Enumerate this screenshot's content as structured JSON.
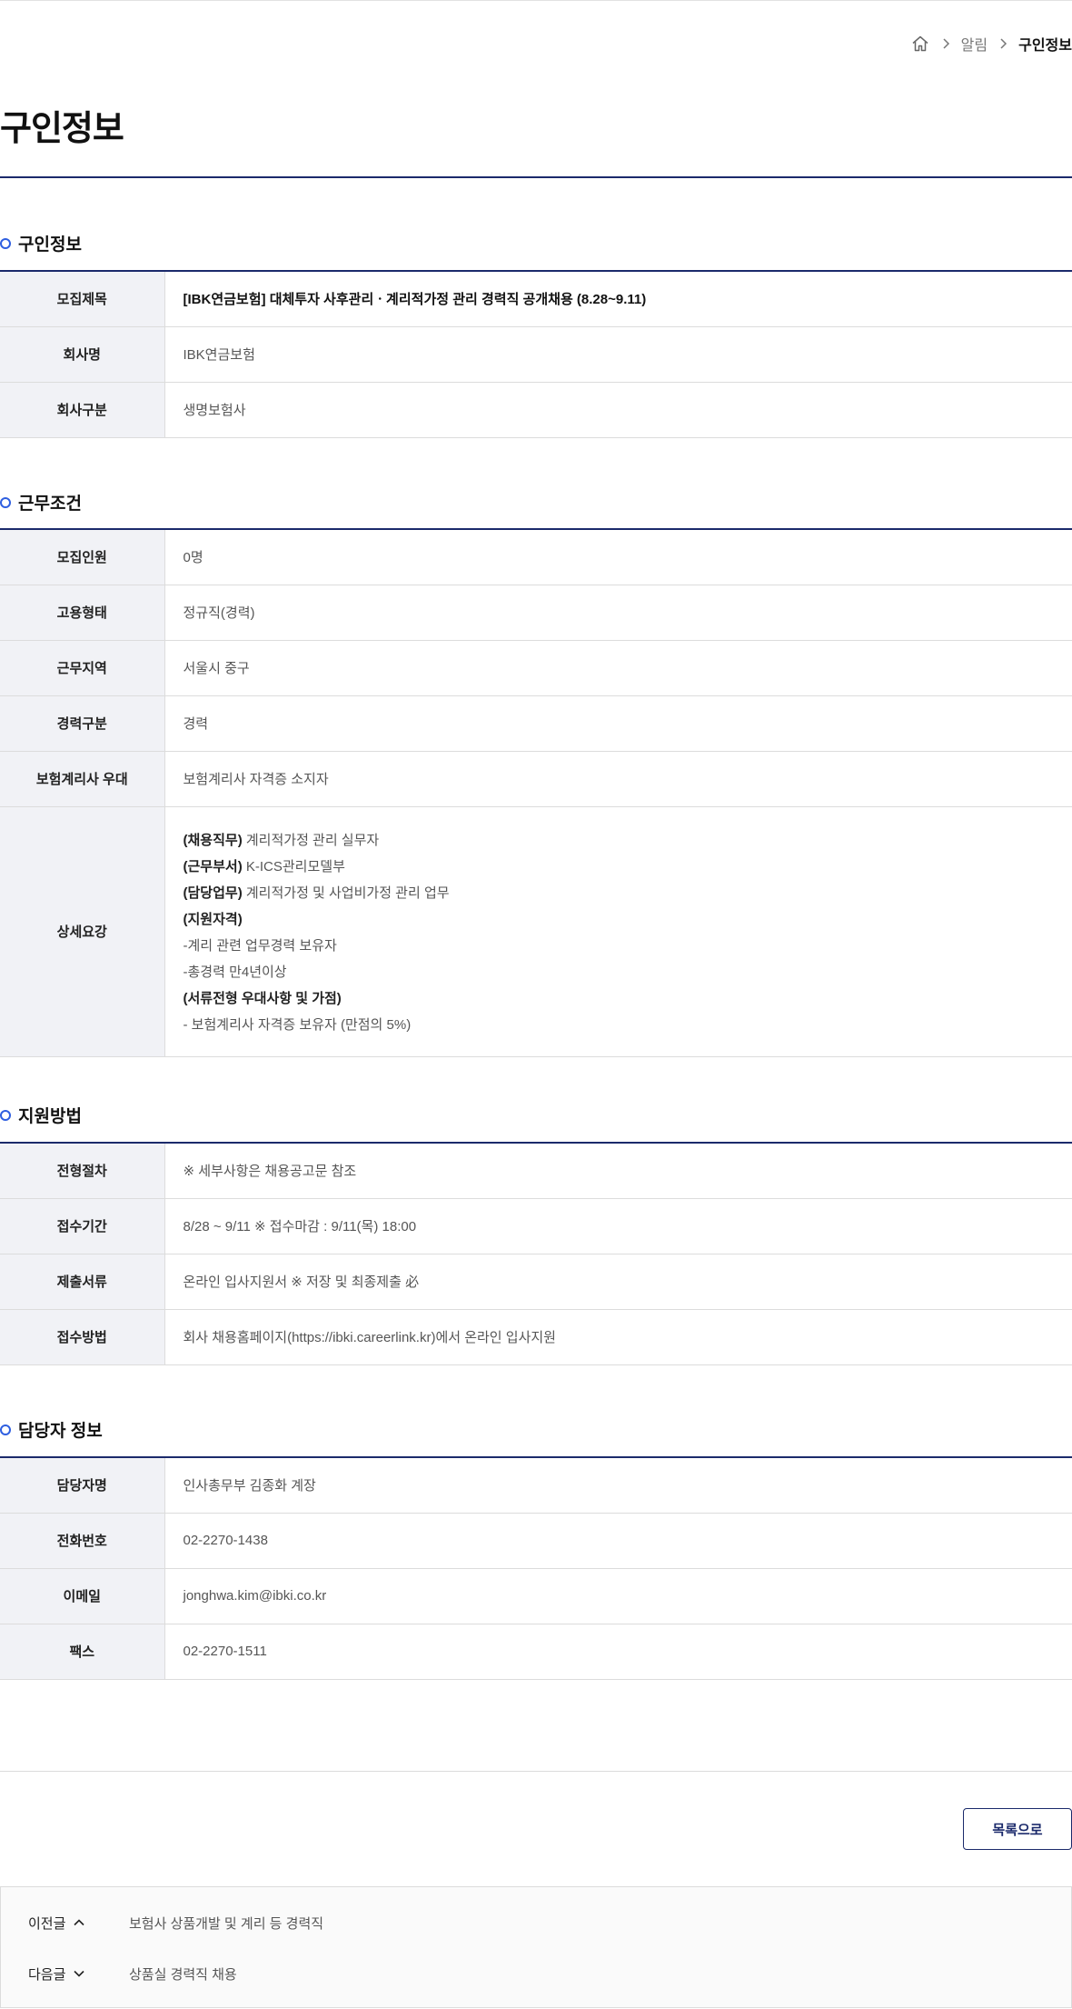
{
  "breadcrumb": {
    "home_icon": "home-icon",
    "items": [
      "알림",
      "구인정보"
    ]
  },
  "page_title": "구인정보",
  "sections": {
    "job_info": {
      "title": "구인정보",
      "rows": [
        {
          "label": "모집제목",
          "value": "[IBK연금보험] 대체투자 사후관리ㆍ계리적가정 관리 경력직 공개채용 (8.28~9.11)"
        },
        {
          "label": "회사명",
          "value": "IBK연금보험"
        },
        {
          "label": "회사구분",
          "value": "생명보험사"
        }
      ]
    },
    "work_conditions": {
      "title": "근무조건",
      "rows": [
        {
          "label": "모집인원",
          "value": "0명"
        },
        {
          "label": "고용형태",
          "value": "정규직(경력)"
        },
        {
          "label": "근무지역",
          "value": "서울시 중구"
        },
        {
          "label": "경력구분",
          "value": "경력"
        },
        {
          "label": "보험계리사 우대",
          "value": "보험계리사 자격증 소지자"
        }
      ],
      "detail": {
        "label": "상세요강",
        "lines": [
          {
            "bold": "(채용직무)",
            "text": " 계리적가정 관리 실무자"
          },
          {
            "bold": "(근무부서)",
            "text": " K-ICS관리모델부"
          },
          {
            "bold": "(담당업무)",
            "text": " 계리적가정 및 사업비가정 관리 업무"
          },
          {
            "bold": "(지원자격)",
            "text": ""
          },
          {
            "bold": "",
            "text": "-계리 관련 업무경력 보유자"
          },
          {
            "bold": "",
            "text": "-총경력 만4년이상"
          },
          {
            "bold": "(서류전형 우대사항 및 가점)",
            "text": ""
          },
          {
            "bold": "",
            "text": "- 보험계리사 자격증 보유자 (만점의 5%)"
          }
        ]
      }
    },
    "apply_method": {
      "title": "지원방법",
      "rows": [
        {
          "label": "전형절차",
          "value": "※ 세부사항은 채용공고문 참조"
        },
        {
          "label": "접수기간",
          "value": "8/28 ~ 9/11 ※ 접수마감 : 9/11(목) 18:00"
        },
        {
          "label": "제출서류",
          "value": "온라인 입사지원서 ※ 저장 및 최종제출 必"
        },
        {
          "label": "접수방법",
          "value": "회사 채용홈페이지(https://ibki.careerlink.kr)에서 온라인 입사지원"
        }
      ]
    },
    "contact": {
      "title": "담당자 정보",
      "rows": [
        {
          "label": "담당자명",
          "value": "인사총무부 김종화 계장"
        },
        {
          "label": "전화번호",
          "value": "02-2270-1438"
        },
        {
          "label": "이메일",
          "value": "jonghwa.kim@ibki.co.kr"
        },
        {
          "label": "팩스",
          "value": "02-2270-1511"
        }
      ]
    }
  },
  "list_button_label": "목록으로",
  "prev_next": {
    "prev": {
      "label": "이전글",
      "title": "보험사 상품개발 및 계리 등 경력직"
    },
    "next": {
      "label": "다음글",
      "title": "상품실 경력직 채용"
    }
  },
  "colors": {
    "accent": "#1b2a6b",
    "dot": "#2f5fe0",
    "header_bg": "#f1f2f6"
  }
}
